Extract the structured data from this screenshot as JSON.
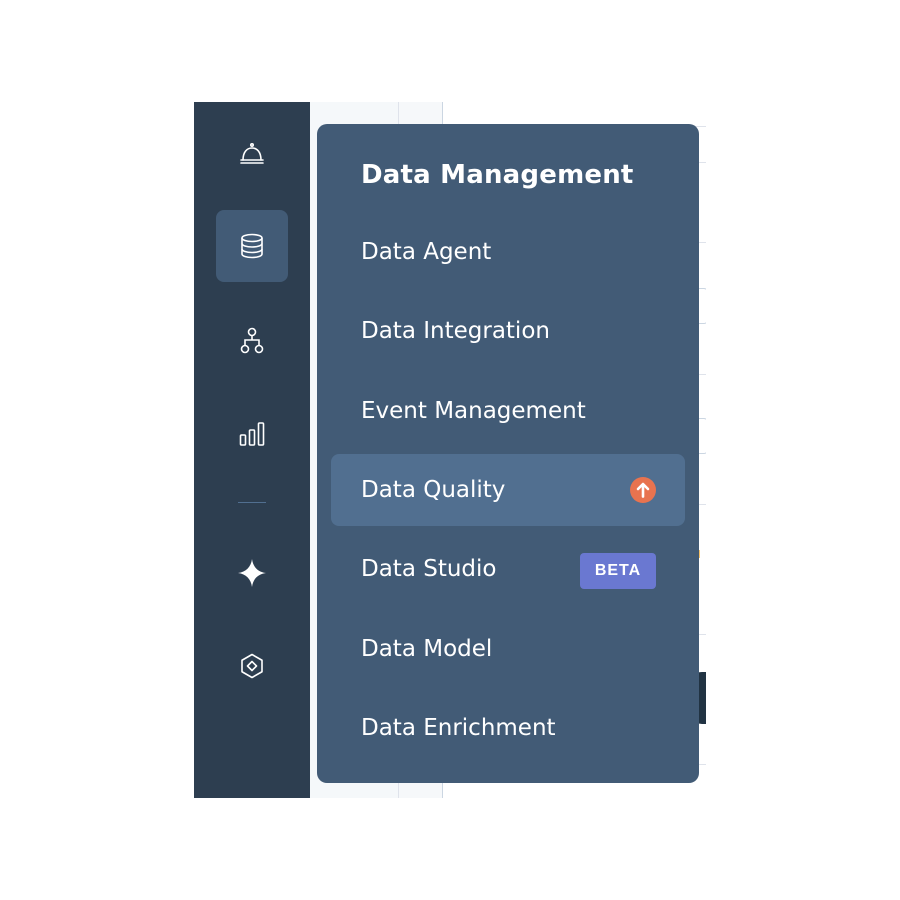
{
  "flyout": {
    "title": "Data Management",
    "items": [
      {
        "label": "Data Agent"
      },
      {
        "label": "Data Integration"
      },
      {
        "label": "Event Management"
      },
      {
        "label": "Data Quality",
        "badge_icon": "upgrade-arrow-icon",
        "hovered": true
      },
      {
        "label": "Data Studio",
        "badge": "BETA"
      },
      {
        "label": "Data Model"
      },
      {
        "label": "Data Enrichment"
      }
    ]
  },
  "rail": {
    "icons": [
      "service-bell-icon",
      "database-icon",
      "hierarchy-icon",
      "bar-chart-icon",
      "sparkle-icon",
      "hexagon-gem-icon"
    ],
    "active": "database-icon"
  },
  "colors": {
    "rail_bg": "#2d3e50",
    "flyout_bg": "#425b76",
    "hover_bg": "#516f90",
    "beta_badge": "#6a78d1",
    "upgrade_icon": "#e8734f"
  }
}
